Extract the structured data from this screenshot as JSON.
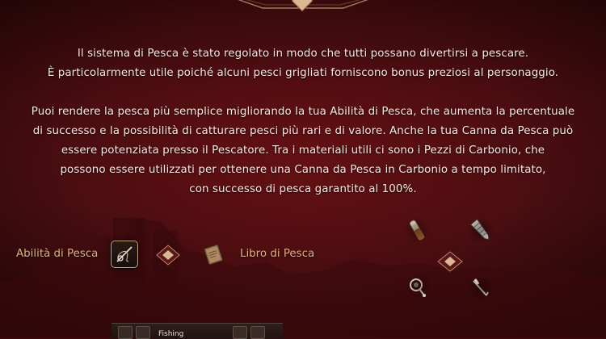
{
  "description": {
    "paragraph1": [
      "Il sistema di Pesca è stato regolato in modo che tutti possano divertirsi a pescare.",
      "È particolarmente utile poiché alcuni pesci grigliati forniscono bonus preziosi al personaggio."
    ],
    "paragraph2": [
      "Puoi rendere la pesca più semplice migliorando la tua Abilità di Pesca, che aumenta la percentuale",
      "di successo e la possibilità di catturare pesci più rari e di valore. Anche la tua Canna da Pesca può",
      "essere potenziata presso il Pescatore. Tra i materiali utili ci sono i Pezzi di Carbonio, che",
      "possono essere utilizzati per ottenere una Canna da Pesca in Carbonio a tempo limitato,",
      "con successo di pesca garantito al 100%."
    ]
  },
  "skill_row": {
    "skill_label": "Abilità di Pesca",
    "book_label": "Libro di Pesca",
    "skill_icon": "fishing-rod-icon",
    "book_icon": "book-icon"
  },
  "materials": [
    {
      "icon": "bait-icon"
    },
    {
      "icon": "drill-icon"
    },
    {
      "icon": "reel-icon"
    },
    {
      "icon": "fishing-hook-icon"
    }
  ],
  "bottom_bar": {
    "tab_label": "Fishing"
  },
  "colors": {
    "background": "#4a0d10",
    "text": "#f4ebe4",
    "label_accent": "#e8b07a",
    "ornament": "#c9a27a"
  }
}
